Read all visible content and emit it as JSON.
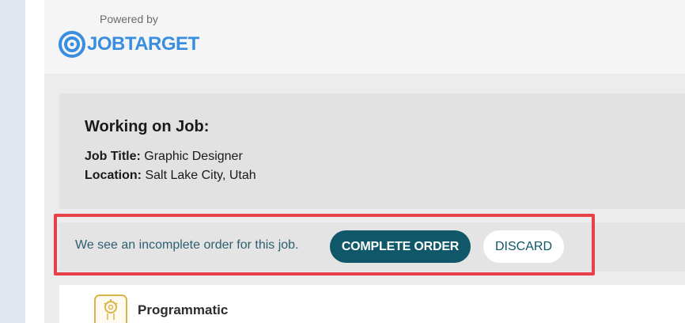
{
  "header": {
    "powered_by": "Powered by",
    "logo_text": "JOBTARGET"
  },
  "job": {
    "heading": "Working on Job:",
    "title_label": "Job Title:",
    "title_value": "Graphic Designer",
    "location_label": "Location:",
    "location_value": "Salt Lake City, Utah"
  },
  "order": {
    "message": "We see an incomplete order for this job.",
    "complete_label": "COMPLETE ORDER",
    "discard_label": "DISCARD"
  },
  "products": {
    "first_label": "Programmatic"
  },
  "colors": {
    "accent": "#0f5769",
    "logo_blue": "#3a8ee0",
    "highlight": "#e94149",
    "icon_gold": "#d8b44a"
  },
  "icons": {
    "logo": "target-logo-icon",
    "programmatic": "gear-circuit-icon"
  }
}
